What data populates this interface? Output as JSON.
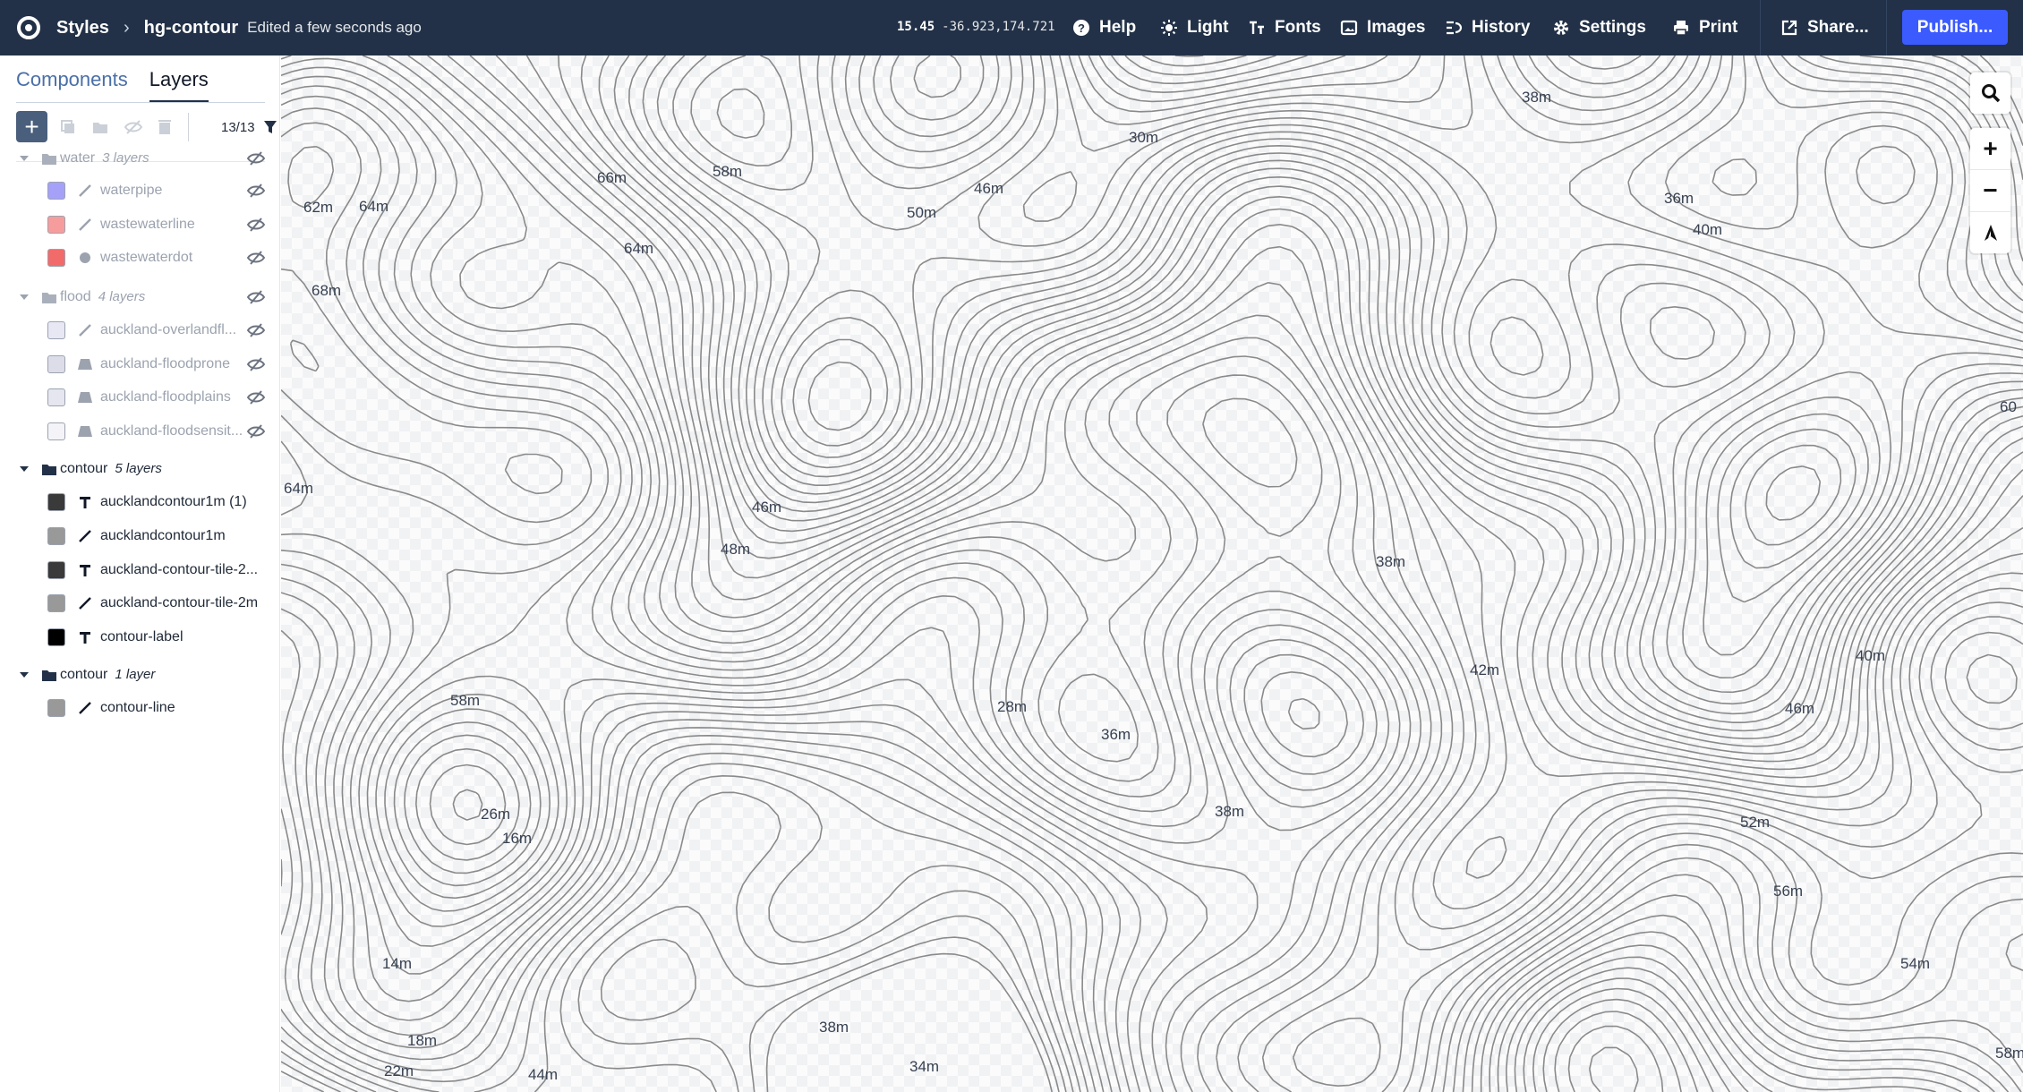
{
  "topbar": {
    "breadcrumb_root": "Styles",
    "project_name": "hg-contour",
    "edited_status": "Edited a few seconds ago",
    "zoom": "15.45",
    "coordinates": "-36.923,174.721",
    "items": {
      "help": "Help",
      "light": "Light",
      "fonts": "Fonts",
      "images": "Images",
      "history": "History",
      "settings": "Settings",
      "print": "Print",
      "share": "Share..."
    },
    "publish": "Publish..."
  },
  "sidebar": {
    "tabs": [
      "Components",
      "Layers"
    ],
    "active_tab": "Layers",
    "filter_count": "13/13",
    "groups": [
      {
        "name": "water",
        "count": "3 layers",
        "hidden": true,
        "layers": [
          {
            "name": "waterpipe",
            "type": "line",
            "color": "#a5a1f8"
          },
          {
            "name": "wastewaterline",
            "type": "line",
            "color": "#f79c9c"
          },
          {
            "name": "wastewaterdot",
            "type": "circle",
            "color": "#f26b6b"
          }
        ]
      },
      {
        "name": "flood",
        "count": "4 layers",
        "hidden": true,
        "layers": [
          {
            "name": "auckland-overlandfl...",
            "type": "line",
            "color": "#e7e8f4"
          },
          {
            "name": "auckland-floodprone",
            "type": "fill",
            "color": "#dcdde8"
          },
          {
            "name": "auckland-floodplains",
            "type": "fill",
            "color": "#e5e6f0"
          },
          {
            "name": "auckland-floodsensit...",
            "type": "fill",
            "color": "#f4f4f8"
          }
        ]
      },
      {
        "name": "contour",
        "count": "5 layers",
        "hidden": false,
        "layers": [
          {
            "name": "aucklandcontour1m (1)",
            "type": "symbol",
            "color": "#3a3a3a"
          },
          {
            "name": "aucklandcontour1m",
            "type": "line",
            "color": "#999999"
          },
          {
            "name": "auckland-contour-tile-2...",
            "type": "symbol",
            "color": "#3a3a3a"
          },
          {
            "name": "auckland-contour-tile-2m",
            "type": "line",
            "color": "#999999"
          },
          {
            "name": "contour-label",
            "type": "symbol",
            "color": "#000000"
          }
        ]
      },
      {
        "name": "contour",
        "count": "1 layer",
        "hidden": false,
        "layers": [
          {
            "name": "contour-line",
            "type": "line",
            "color": "#999999"
          }
        ]
      }
    ]
  },
  "map": {
    "contour_color": "#8a8a8a",
    "labels": [
      "38m",
      "30m",
      "36m",
      "40m",
      "58m",
      "66m",
      "46m",
      "50m",
      "62m",
      "64m",
      "64m",
      "68m",
      "64m",
      "46m",
      "48m",
      "38m",
      "42m",
      "40m",
      "58m",
      "28m",
      "36m",
      "46m",
      "38m",
      "26m",
      "16m",
      "52m",
      "56m",
      "14m",
      "54m",
      "38m",
      "18m",
      "22m",
      "44m",
      "34m",
      "58m",
      "60"
    ]
  },
  "map_controls": {
    "search": "search-icon",
    "zoom_in": "+",
    "zoom_out": "−",
    "compass": "compass-icon"
  }
}
